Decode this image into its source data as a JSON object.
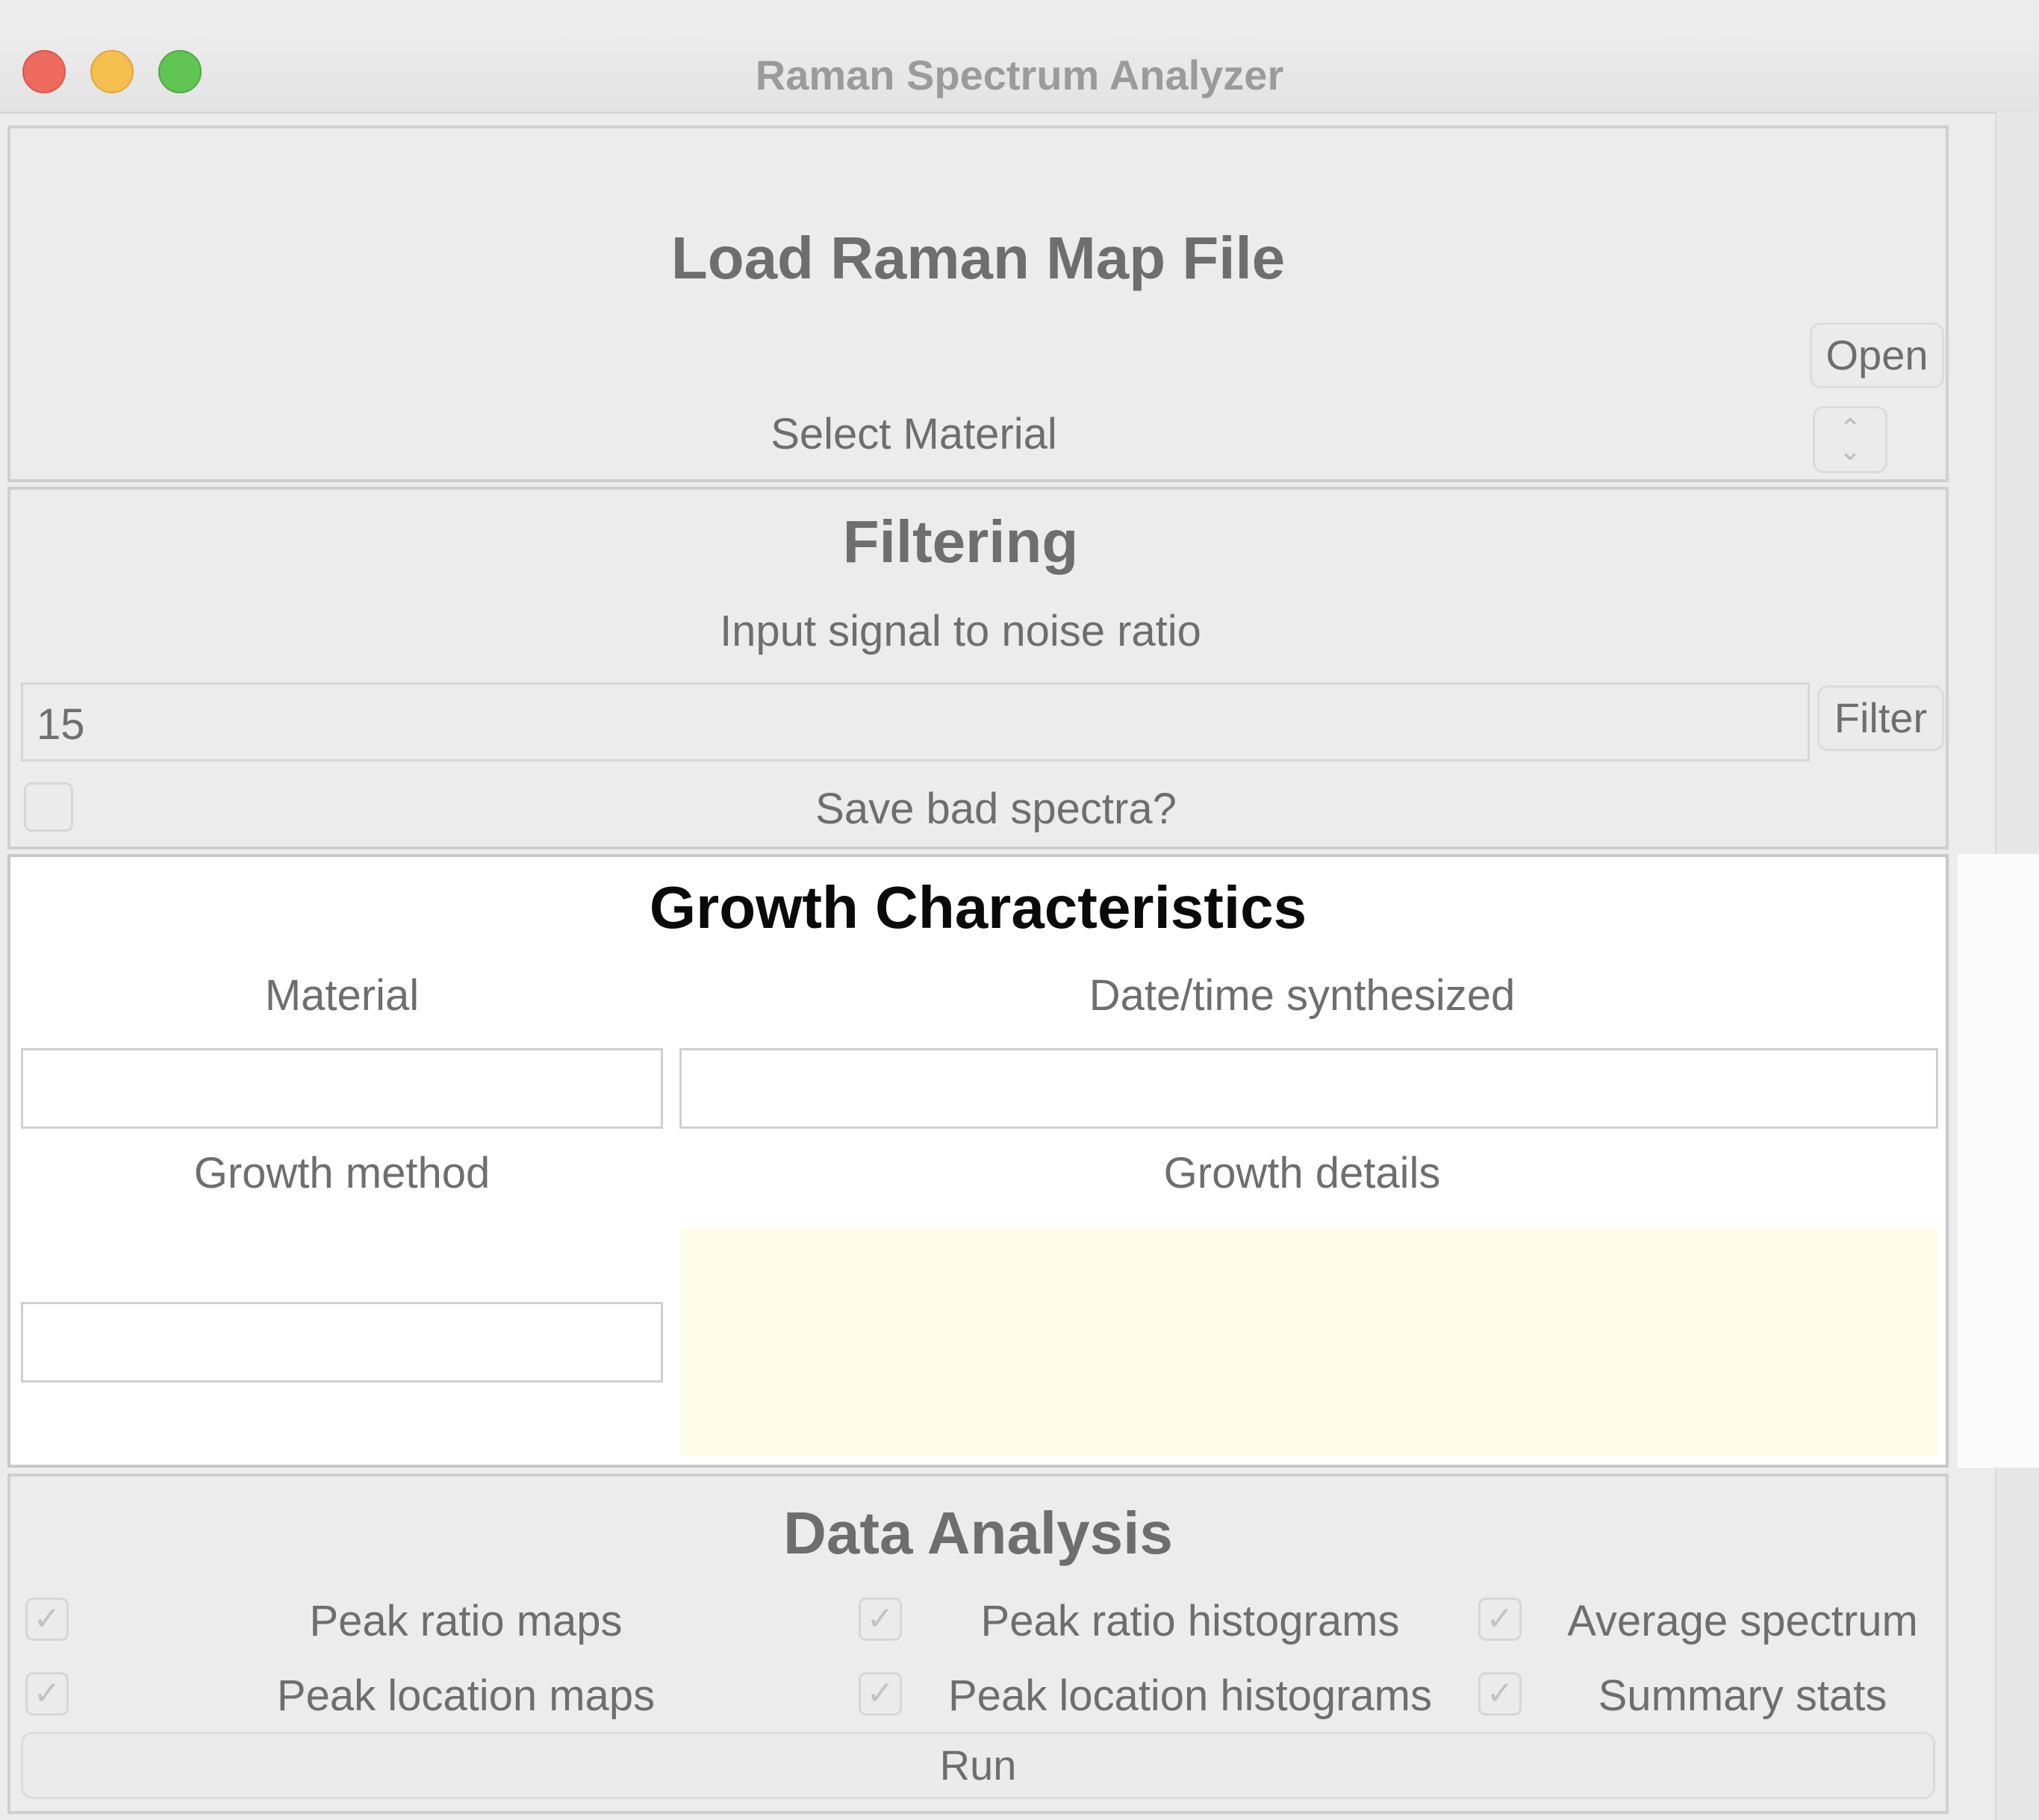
{
  "window": {
    "title": "Raman Spectrum Analyzer"
  },
  "load_panel": {
    "heading": "Load Raman Map File",
    "open_button": "Open",
    "select_material": "Select Material"
  },
  "filter_panel": {
    "heading": "Filtering",
    "snr_label": "Input signal to noise ratio",
    "snr_value": "15",
    "filter_button": "Filter",
    "save_bad_label": "Save bad spectra?"
  },
  "growth_panel": {
    "heading": "Growth Characteristics",
    "material_label": "Material",
    "datetime_label": "Date/time synthesized",
    "method_label": "Growth method",
    "details_label": "Growth details",
    "details_bg": "#fffde8"
  },
  "analysis_panel": {
    "heading": "Data Analysis",
    "options": [
      {
        "label": "Peak ratio maps",
        "checked": true
      },
      {
        "label": "Peak ratio histograms",
        "checked": true
      },
      {
        "label": "Average spectrum",
        "checked": true
      },
      {
        "label": "Peak location maps",
        "checked": true
      },
      {
        "label": "Peak location histograms",
        "checked": true
      },
      {
        "label": "Summary stats",
        "checked": true
      }
    ],
    "run_button": "Run",
    "check_glyph": "✓"
  },
  "colors": {
    "close": "#ed6a5e",
    "minimize": "#f5bf4f",
    "zoom": "#61c554"
  }
}
